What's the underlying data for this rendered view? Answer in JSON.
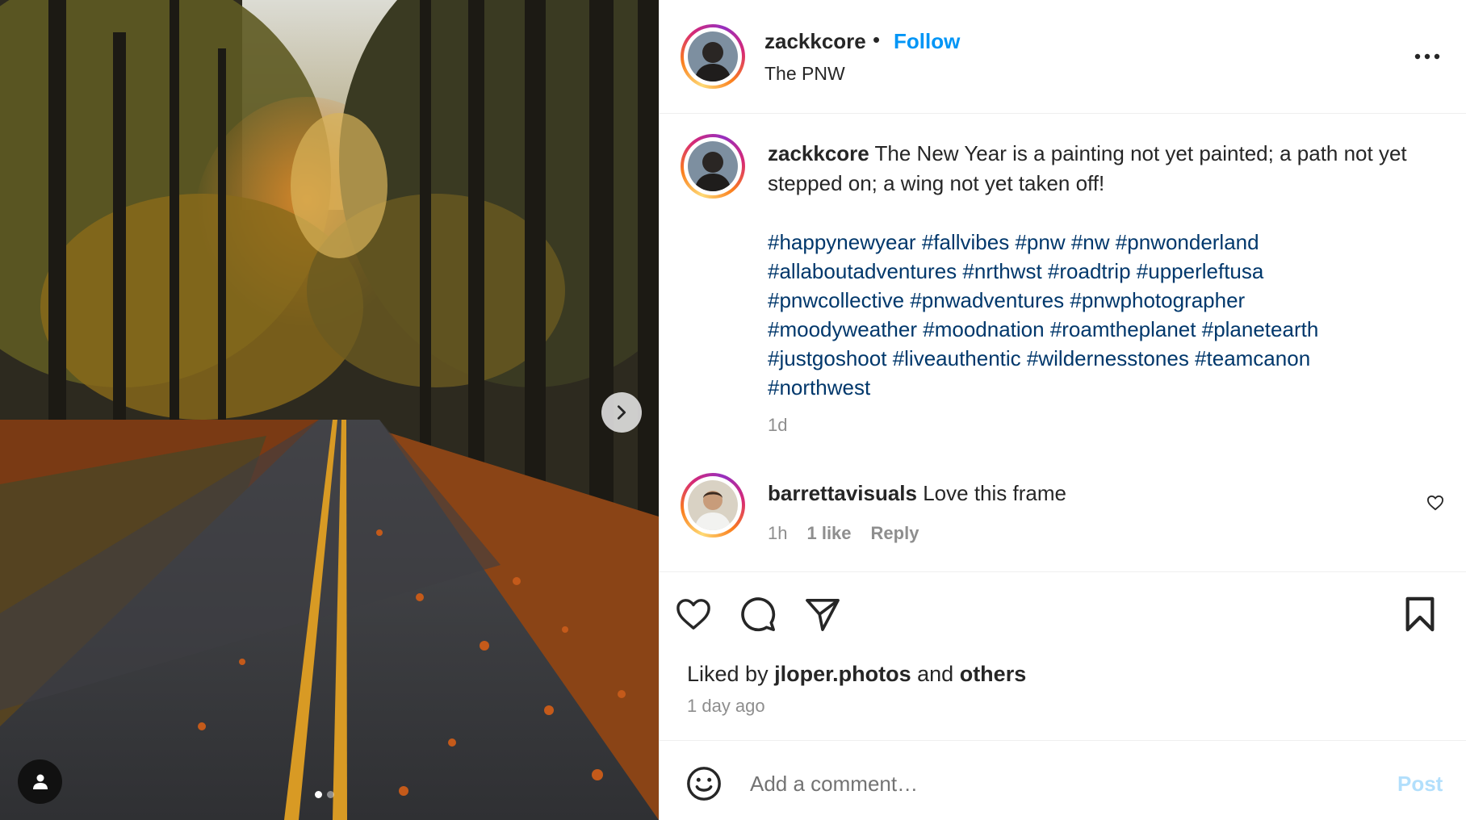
{
  "post": {
    "username": "zackkcore",
    "separator": "•",
    "follow_label": "Follow",
    "location": "The PNW",
    "caption_text": "The New Year is a painting not yet painted; a path not yet stepped on; a wing not yet taken off!",
    "hashtags": [
      "#happynewyear",
      "#fallvibes",
      "#pnw",
      "#nw",
      "#pnwonderland",
      "#allaboutadventures",
      "#nrthwst",
      "#roadtrip",
      "#upperleftusa",
      "#pnwcollective",
      "#pnwadventures",
      "#pnwphotographer",
      "#moodyweather",
      "#moodnation",
      "#roamtheplanet",
      "#planetearth",
      "#justgoshoot",
      "#liveauthentic",
      "#wildernesstones",
      "#teamcanon",
      "#northwest"
    ],
    "caption_time": "1d"
  },
  "comment": {
    "username": "barrettavisuals",
    "text": "Love this frame",
    "time": "1h",
    "likes": "1 like",
    "reply_label": "Reply"
  },
  "likes": {
    "prefix": "Liked by",
    "user": "jloper.photos",
    "and": "and",
    "others": "others"
  },
  "post_time": "1 day ago",
  "add_comment": {
    "placeholder": "Add a comment…",
    "post_label": "Post"
  },
  "carousel": {
    "total_slides": 2,
    "current_slide": 1
  },
  "icons": {
    "more": "more-horizontal-icon",
    "like": "heart-icon",
    "comment": "comment-bubble-icon",
    "share": "paper-plane-icon",
    "save": "bookmark-icon",
    "emoji": "smiley-icon",
    "next": "chevron-right-icon",
    "tag": "user-tag-icon"
  },
  "colors": {
    "link_blue": "#0095f6",
    "hashtag_blue": "#00376b",
    "muted": "#8e8e8e",
    "post_disabled": "#b2dffc"
  }
}
